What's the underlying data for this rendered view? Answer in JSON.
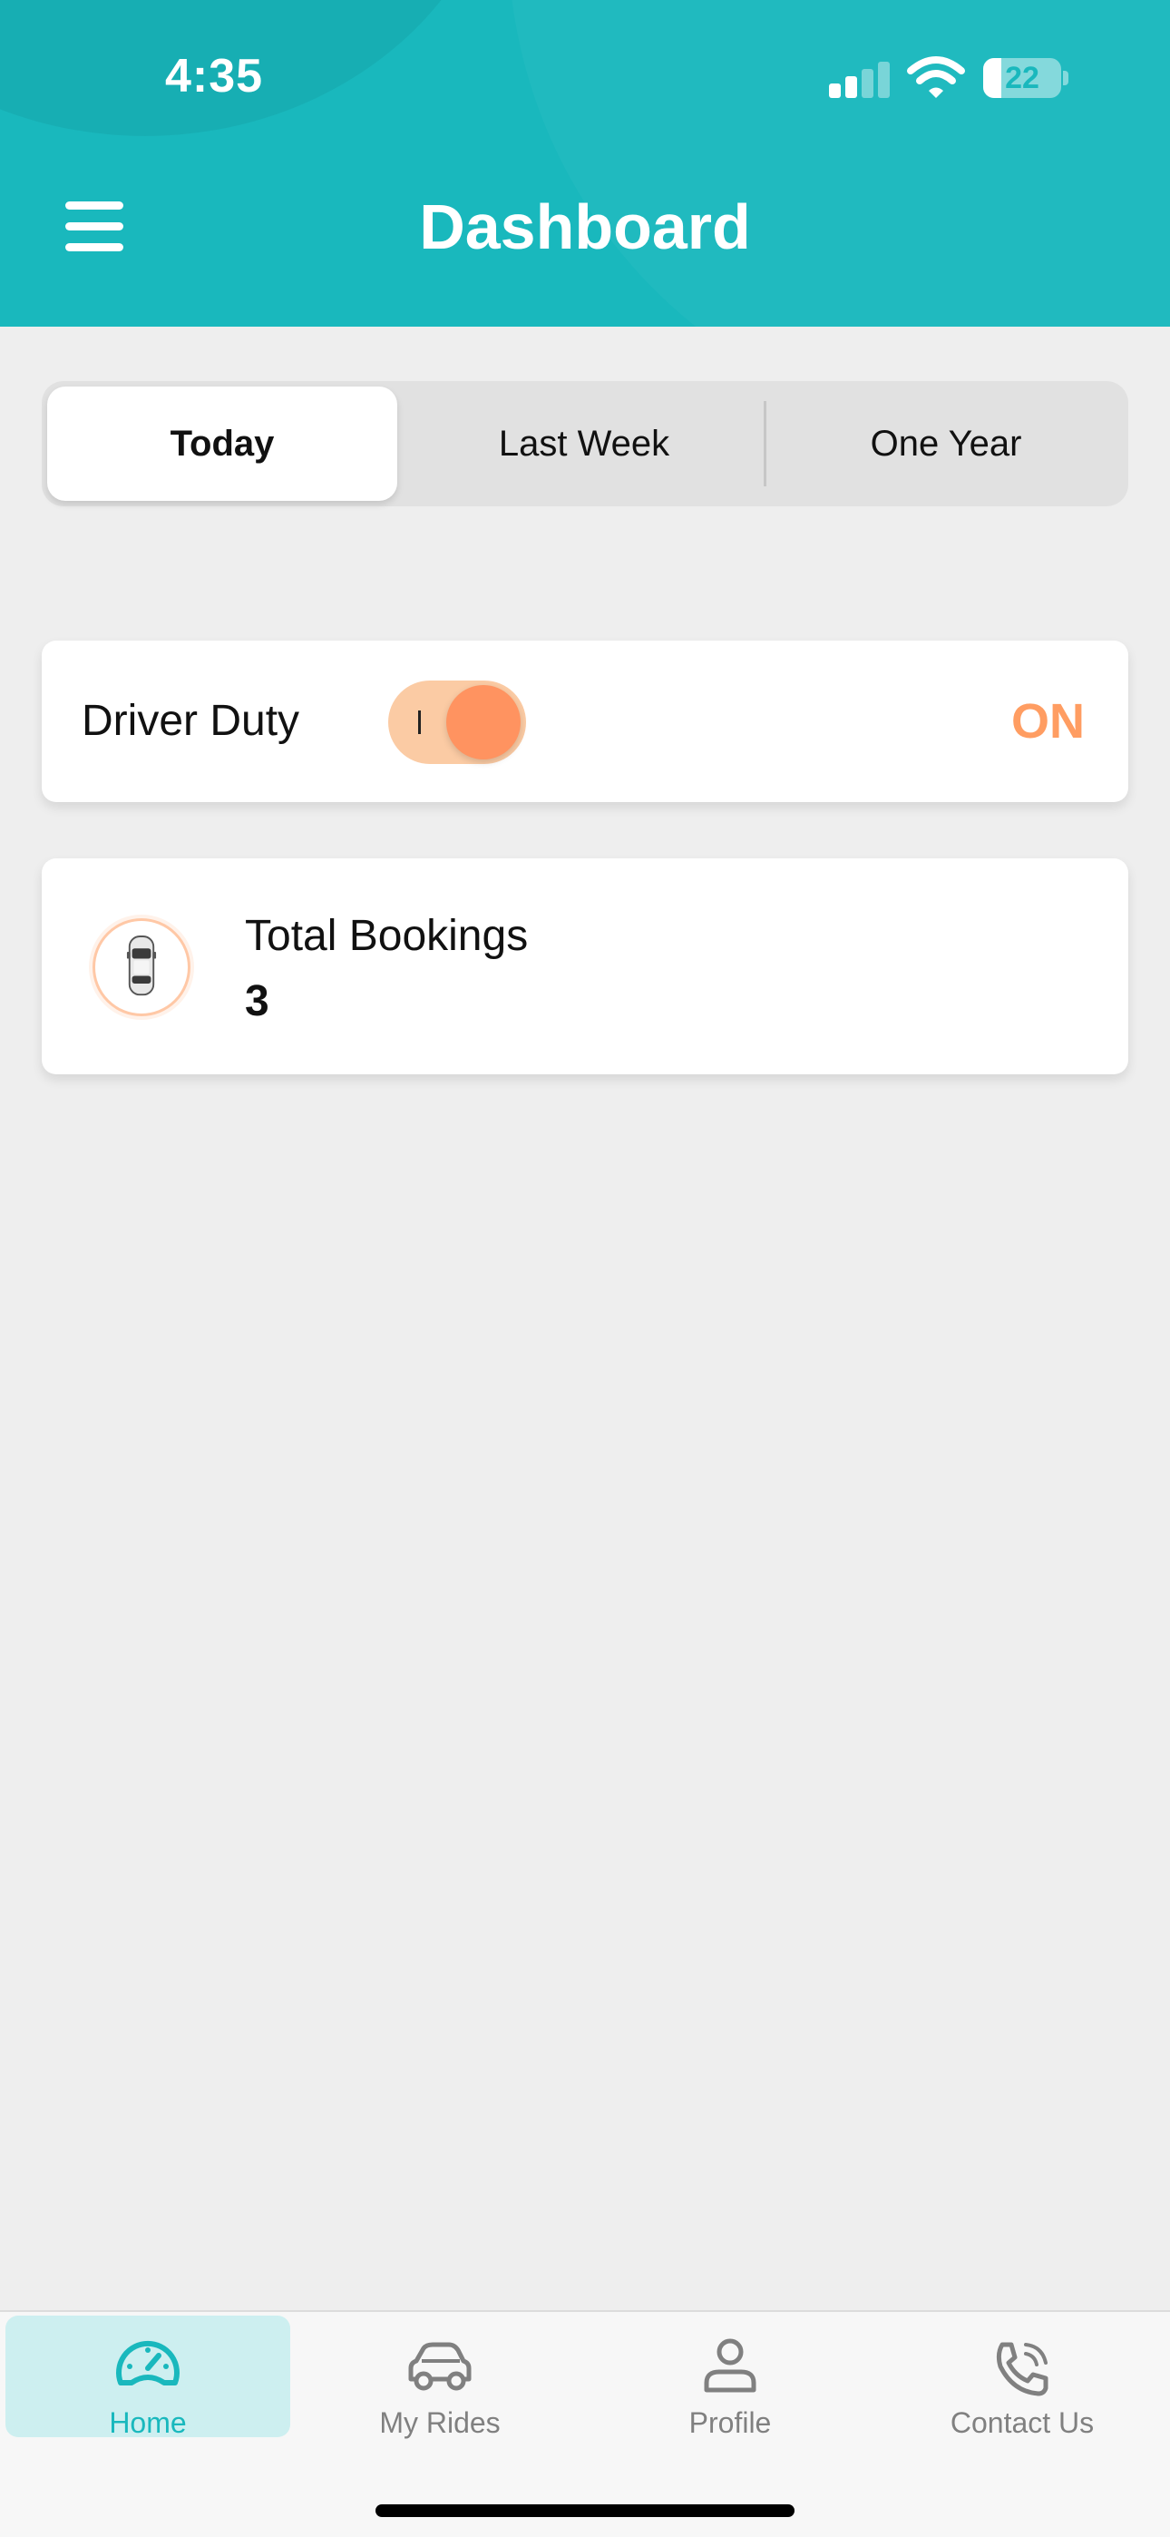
{
  "status_bar": {
    "time": "4:35",
    "battery": "22",
    "icons": [
      "cellular-signal-icon",
      "wifi-icon",
      "battery-icon"
    ]
  },
  "header": {
    "title": "Dashboard",
    "menu_icon": "hamburger-menu-icon",
    "color": "#19b8bd"
  },
  "segments": {
    "items": [
      {
        "label": "Today",
        "selected": true
      },
      {
        "label": "Last Week",
        "selected": false
      },
      {
        "label": "One Year",
        "selected": false
      }
    ]
  },
  "duty_card": {
    "label": "Driver Duty",
    "toggle_on": true,
    "state": "ON",
    "accent": "#ff9360"
  },
  "bookings_card": {
    "icon": "car-icon",
    "label": "Total Bookings",
    "value": "3"
  },
  "bottom_nav": {
    "items": [
      {
        "label": "Home",
        "icon": "speedometer-icon",
        "active": true
      },
      {
        "label": "My Rides",
        "icon": "car-icon",
        "active": false
      },
      {
        "label": "Profile",
        "icon": "user-icon",
        "active": false
      },
      {
        "label": "Contact Us",
        "icon": "phone-call-icon",
        "active": false
      }
    ]
  }
}
